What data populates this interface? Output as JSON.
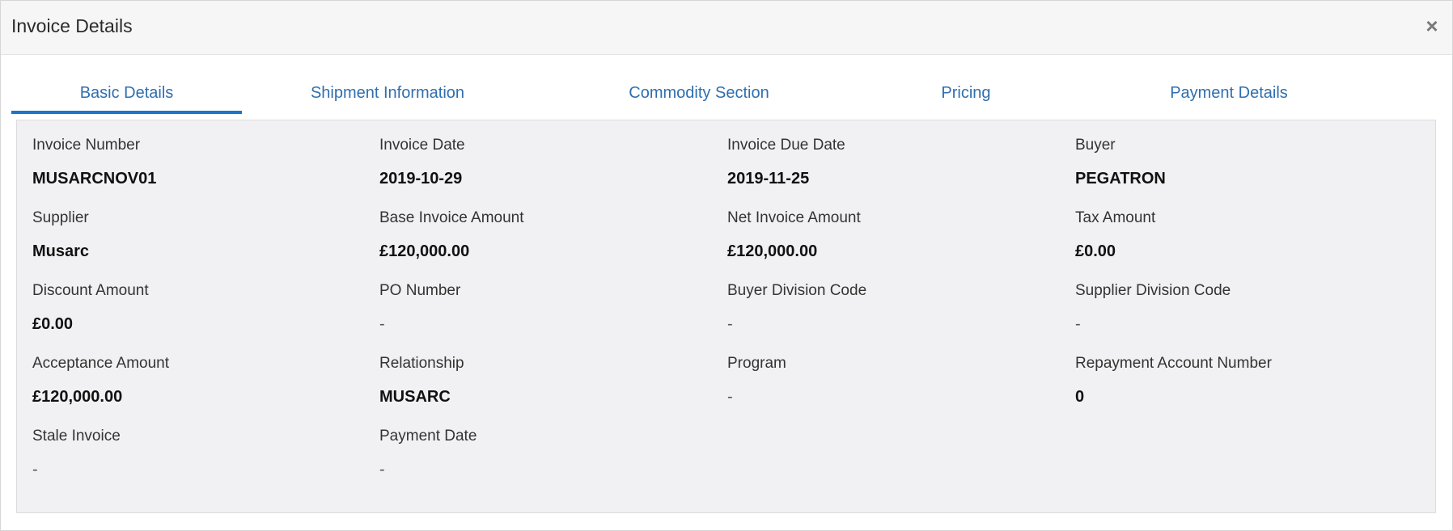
{
  "dialog": {
    "title": "Invoice Details",
    "close_icon": "close-icon",
    "close_glyph": "×"
  },
  "tabs": [
    {
      "label": "Basic Details",
      "active": true
    },
    {
      "label": "Shipment Information",
      "active": false
    },
    {
      "label": "Commodity Section",
      "active": false
    },
    {
      "label": "Pricing",
      "active": false
    },
    {
      "label": "Payment Details",
      "active": false
    }
  ],
  "colors": {
    "accent": "#1c75c8",
    "tab_text": "#2f6fb0",
    "panel_bg": "#f1f1f3"
  },
  "fields": {
    "invoice_number": {
      "label": "Invoice Number",
      "value": "MUSARCNOV01"
    },
    "invoice_date": {
      "label": "Invoice Date",
      "value": "2019-10-29"
    },
    "invoice_due_date": {
      "label": "Invoice Due Date",
      "value": "2019-11-25"
    },
    "buyer": {
      "label": "Buyer",
      "value": "PEGATRON"
    },
    "supplier": {
      "label": "Supplier",
      "value": "Musarc"
    },
    "base_invoice_amount": {
      "label": "Base Invoice Amount",
      "value": "£120,000.00"
    },
    "net_invoice_amount": {
      "label": "Net Invoice Amount",
      "value": "£120,000.00"
    },
    "tax_amount": {
      "label": "Tax Amount",
      "value": "£0.00"
    },
    "discount_amount": {
      "label": "Discount Amount",
      "value": "£0.00"
    },
    "po_number": {
      "label": "PO Number",
      "value": "-"
    },
    "buyer_division_code": {
      "label": "Buyer Division Code",
      "value": "-"
    },
    "supplier_division_code": {
      "label": "Supplier Division Code",
      "value": "-"
    },
    "acceptance_amount": {
      "label": "Acceptance Amount",
      "value": "£120,000.00"
    },
    "relationship": {
      "label": "Relationship",
      "value": "MUSARC"
    },
    "program": {
      "label": "Program",
      "value": "-"
    },
    "repayment_account_number": {
      "label": "Repayment Account Number",
      "value": "0"
    },
    "stale_invoice": {
      "label": "Stale Invoice",
      "value": "-"
    },
    "payment_date": {
      "label": "Payment Date",
      "value": "-"
    }
  }
}
